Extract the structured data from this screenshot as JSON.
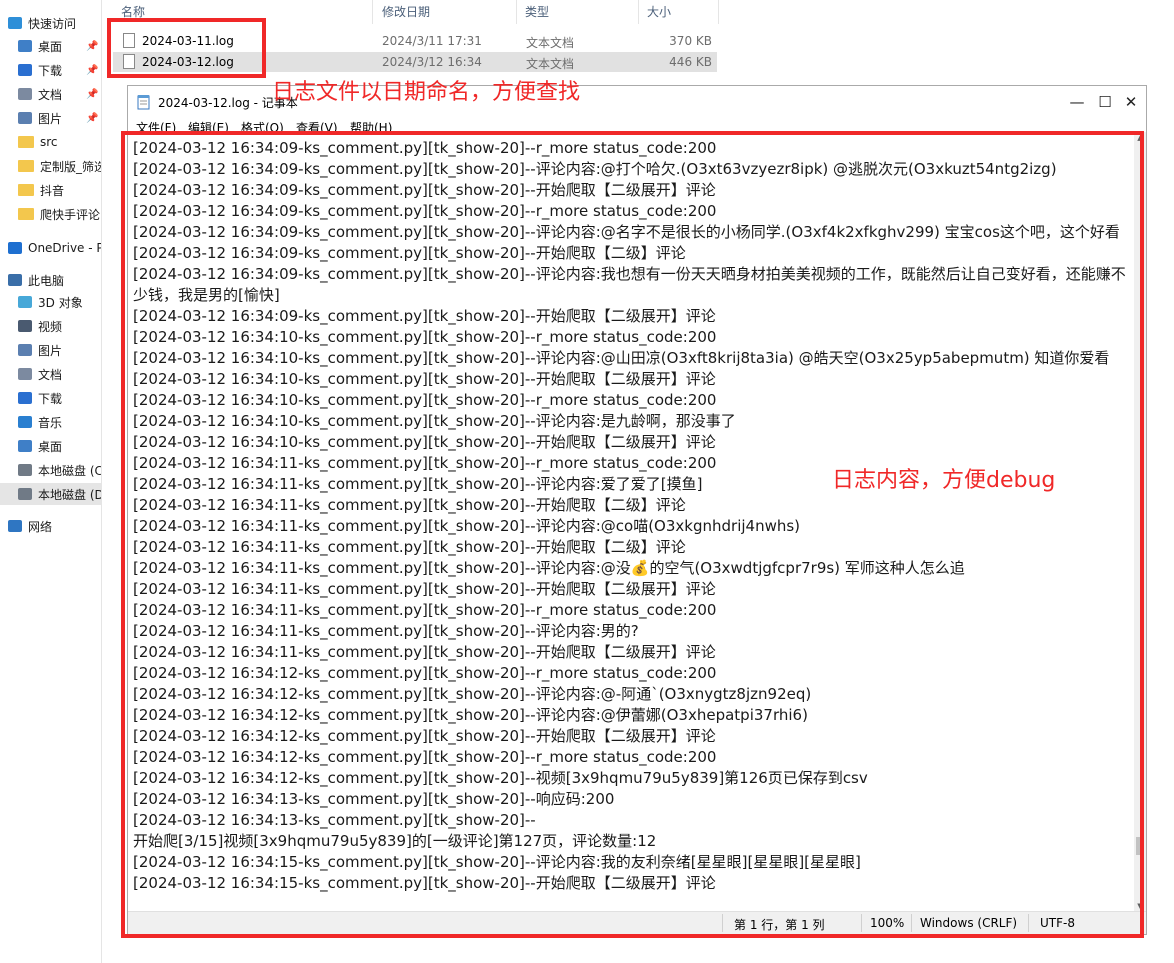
{
  "nav": {
    "items": [
      {
        "label": "快速访问",
        "icon": "star-icon"
      },
      {
        "label": "桌面",
        "icon": "desktop-icon",
        "pinned": true
      },
      {
        "label": "下载",
        "icon": "download-icon",
        "pinned": true
      },
      {
        "label": "文档",
        "icon": "document-icon",
        "pinned": true
      },
      {
        "label": "图片",
        "icon": "picture-icon",
        "pinned": true
      },
      {
        "label": "src",
        "icon": "folder-icon"
      },
      {
        "label": "定制版_筛选",
        "icon": "folder-icon"
      },
      {
        "label": "抖音",
        "icon": "folder-icon"
      },
      {
        "label": "爬快手评论(",
        "icon": "folder-icon"
      },
      {
        "label": "OneDrive - P",
        "icon": "cloud-icon"
      },
      {
        "label": "此电脑",
        "icon": "computer-icon"
      },
      {
        "label": "3D 对象",
        "icon": "cube-icon"
      },
      {
        "label": "视频",
        "icon": "video-icon"
      },
      {
        "label": "图片",
        "icon": "picture-icon"
      },
      {
        "label": "文档",
        "icon": "document-icon"
      },
      {
        "label": "下载",
        "icon": "download-icon"
      },
      {
        "label": "音乐",
        "icon": "music-icon"
      },
      {
        "label": "桌面",
        "icon": "desktop-icon"
      },
      {
        "label": "本地磁盘 (C",
        "icon": "drive-icon"
      },
      {
        "label": "本地磁盘 (D",
        "icon": "drive-icon"
      },
      {
        "label": "网络",
        "icon": "network-icon"
      }
    ]
  },
  "files": {
    "columns": [
      "名称",
      "修改日期",
      "类型",
      "大小"
    ],
    "rows": [
      {
        "name": "2024-03-11.log",
        "date": "2024/3/11 17:31",
        "type": "文本文档",
        "size": "370 KB"
      },
      {
        "name": "2024-03-12.log",
        "date": "2024/3/12 16:34",
        "type": "文本文档",
        "size": "446 KB"
      }
    ]
  },
  "notepad": {
    "title": "2024-03-12.log - 记事本",
    "menu": [
      "文件(F)",
      "编辑(E)",
      "格式(O)",
      "查看(V)",
      "帮助(H)"
    ],
    "lines": [
      "[2024-03-12 16:34:09-ks_comment.py][tk_show-20]--r_more status_code:200",
      "[2024-03-12 16:34:09-ks_comment.py][tk_show-20]--评论内容:@打个哈欠.(O3xt63vzyezr8ipk) @逃脱次元(O3xkuzt54ntg2izg)",
      "[2024-03-12 16:34:09-ks_comment.py][tk_show-20]--开始爬取【二级展开】评论",
      "[2024-03-12 16:34:09-ks_comment.py][tk_show-20]--r_more status_code:200",
      "[2024-03-12 16:34:09-ks_comment.py][tk_show-20]--评论内容:@名字不是很长的小杨同学.(O3xf4k2xfkghv299) 宝宝cos这个吧，这个好看",
      "[2024-03-12 16:34:09-ks_comment.py][tk_show-20]--开始爬取【二级】评论",
      "[2024-03-12 16:34:09-ks_comment.py][tk_show-20]--评论内容:我也想有一份天天晒身材拍美美视频的工作，既能然后让自己变好看，还能赚不少钱，我是男的[愉快]",
      "[2024-03-12 16:34:09-ks_comment.py][tk_show-20]--开始爬取【二级展开】评论",
      "[2024-03-12 16:34:10-ks_comment.py][tk_show-20]--r_more status_code:200",
      "[2024-03-12 16:34:10-ks_comment.py][tk_show-20]--评论内容:@山田凉(O3xft8krij8ta3ia) @皓天空(O3x25yp5abepmutm) 知道你爱看",
      "[2024-03-12 16:34:10-ks_comment.py][tk_show-20]--开始爬取【二级展开】评论",
      "[2024-03-12 16:34:10-ks_comment.py][tk_show-20]--r_more status_code:200",
      "[2024-03-12 16:34:10-ks_comment.py][tk_show-20]--评论内容:是九龄啊，那没事了",
      "[2024-03-12 16:34:10-ks_comment.py][tk_show-20]--开始爬取【二级展开】评论",
      "[2024-03-12 16:34:11-ks_comment.py][tk_show-20]--r_more status_code:200",
      "[2024-03-12 16:34:11-ks_comment.py][tk_show-20]--评论内容:爱了爱了[摸鱼]",
      "[2024-03-12 16:34:11-ks_comment.py][tk_show-20]--开始爬取【二级】评论",
      "[2024-03-12 16:34:11-ks_comment.py][tk_show-20]--评论内容:@co喵(O3xkgnhdrij4nwhs)",
      "[2024-03-12 16:34:11-ks_comment.py][tk_show-20]--开始爬取【二级】评论",
      "[2024-03-12 16:34:11-ks_comment.py][tk_show-20]--评论内容:@没💰的空气(O3xwdtjgfcpr7r9s) 军师这种人怎么追",
      "[2024-03-12 16:34:11-ks_comment.py][tk_show-20]--开始爬取【二级展开】评论",
      "[2024-03-12 16:34:11-ks_comment.py][tk_show-20]--r_more status_code:200",
      "[2024-03-12 16:34:11-ks_comment.py][tk_show-20]--评论内容:男的?",
      "[2024-03-12 16:34:11-ks_comment.py][tk_show-20]--开始爬取【二级展开】评论",
      "[2024-03-12 16:34:12-ks_comment.py][tk_show-20]--r_more status_code:200",
      "[2024-03-12 16:34:12-ks_comment.py][tk_show-20]--评论内容:@-阿通`(O3xnygtz8jzn92eq)",
      "[2024-03-12 16:34:12-ks_comment.py][tk_show-20]--评论内容:@伊蕾娜(O3xhepatpi37rhi6)",
      "[2024-03-12 16:34:12-ks_comment.py][tk_show-20]--开始爬取【二级展开】评论",
      "[2024-03-12 16:34:12-ks_comment.py][tk_show-20]--r_more status_code:200",
      "[2024-03-12 16:34:12-ks_comment.py][tk_show-20]--视频[3x9hqmu79u5y839]第126页已保存到csv",
      "[2024-03-12 16:34:13-ks_comment.py][tk_show-20]--响应码:200",
      "[2024-03-12 16:34:13-ks_comment.py][tk_show-20]--\n开始爬[3/15]视频[3x9hqmu79u5y839]的[一级评论]第127页，评论数量:12",
      "[2024-03-12 16:34:15-ks_comment.py][tk_show-20]--评论内容:我的友利奈绪[星星眼][星星眼][星星眼]",
      "[2024-03-12 16:34:15-ks_comment.py][tk_show-20]--开始爬取【二级展开】评论"
    ],
    "status": {
      "position": "第 1 行，第 1 列",
      "zoom": "100%",
      "eol": "Windows (CRLF)",
      "encoding": "UTF-8"
    }
  },
  "annotations": {
    "filename_note": "日志文件以日期命名，方便查找",
    "content_note": "日志内容，方便debug",
    "color": "#f02828"
  }
}
